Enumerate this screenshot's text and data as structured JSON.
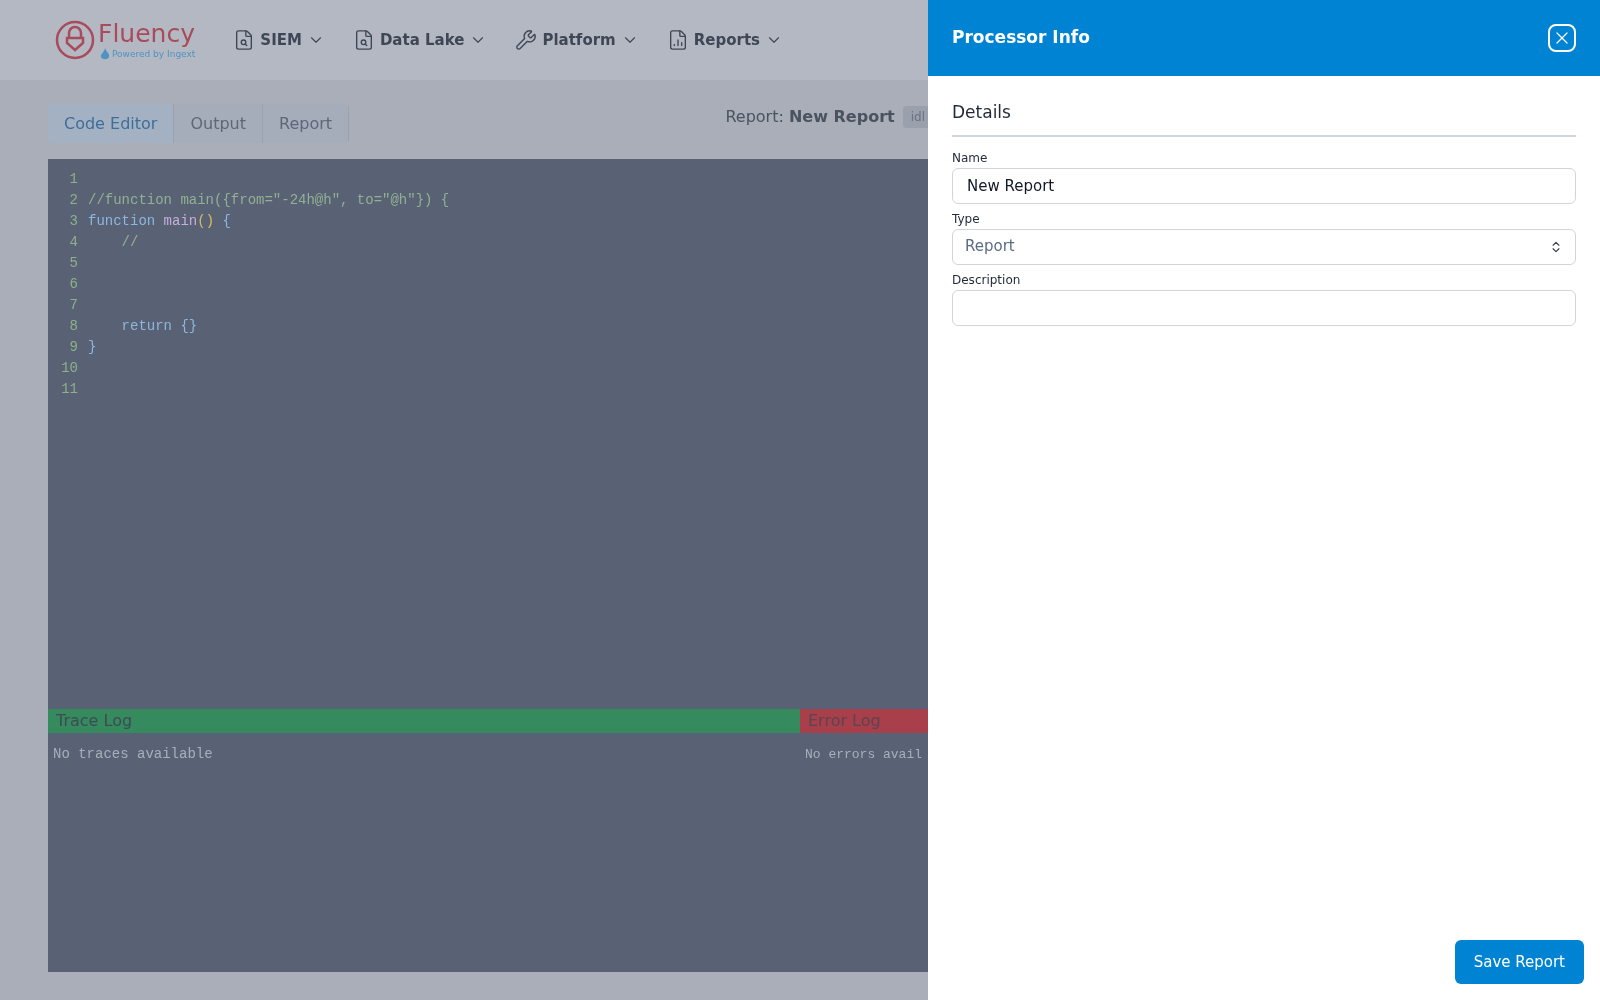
{
  "logo": {
    "name": "Fluency",
    "tagline": "Powered by Ingext"
  },
  "nav": [
    {
      "label": "SIEM",
      "kind": "search-file"
    },
    {
      "label": "Data Lake",
      "kind": "search-file"
    },
    {
      "label": "Platform",
      "kind": "wrench"
    },
    {
      "label": "Reports",
      "kind": "chart-file"
    }
  ],
  "tabs": [
    {
      "label": "Code Editor",
      "selected": true
    },
    {
      "label": "Output",
      "selected": false
    },
    {
      "label": "Report",
      "selected": false
    }
  ],
  "report": {
    "prefix": "Report:",
    "name": "New Report",
    "status": "idl"
  },
  "editor": {
    "lines": [
      {
        "number": "1"
      },
      {
        "number": "2",
        "tokens": [
          {
            "text": "//function main({from=\"-24h@h\", to=\"@h\"}) {",
            "kind": "comment"
          }
        ]
      },
      {
        "number": "3",
        "tokens": [
          {
            "text": "function",
            "kind": "keyword"
          },
          {
            "text": " main",
            "kind": "function"
          },
          {
            "text": "()",
            "kind": "paren"
          },
          {
            "text": " {",
            "kind": "brace"
          }
        ]
      },
      {
        "number": "4",
        "tokens": [
          {
            "text": "    //",
            "kind": "comment"
          }
        ]
      },
      {
        "number": "5"
      },
      {
        "number": "6"
      },
      {
        "number": "7"
      },
      {
        "number": "8",
        "tokens": [
          {
            "text": "    return",
            "kind": "keyword"
          },
          {
            "text": " {}",
            "kind": "brace"
          }
        ]
      },
      {
        "number": "9",
        "tokens": [
          {
            "text": "}",
            "kind": "brace"
          }
        ]
      },
      {
        "number": "10"
      },
      {
        "number": "11"
      }
    ]
  },
  "trace_log": {
    "title": "Trace Log",
    "message": "No traces available"
  },
  "error_log": {
    "title": "Error Log",
    "message": "No errors avail"
  },
  "drawer": {
    "title": "Processor Info",
    "section": "Details",
    "fields": [
      {
        "label": "Name",
        "kind": "text",
        "value": "New Report"
      },
      {
        "label": "Type",
        "kind": "select",
        "value": "Report"
      },
      {
        "label": "Description",
        "kind": "text"
      }
    ],
    "save_button": "Save Report"
  }
}
